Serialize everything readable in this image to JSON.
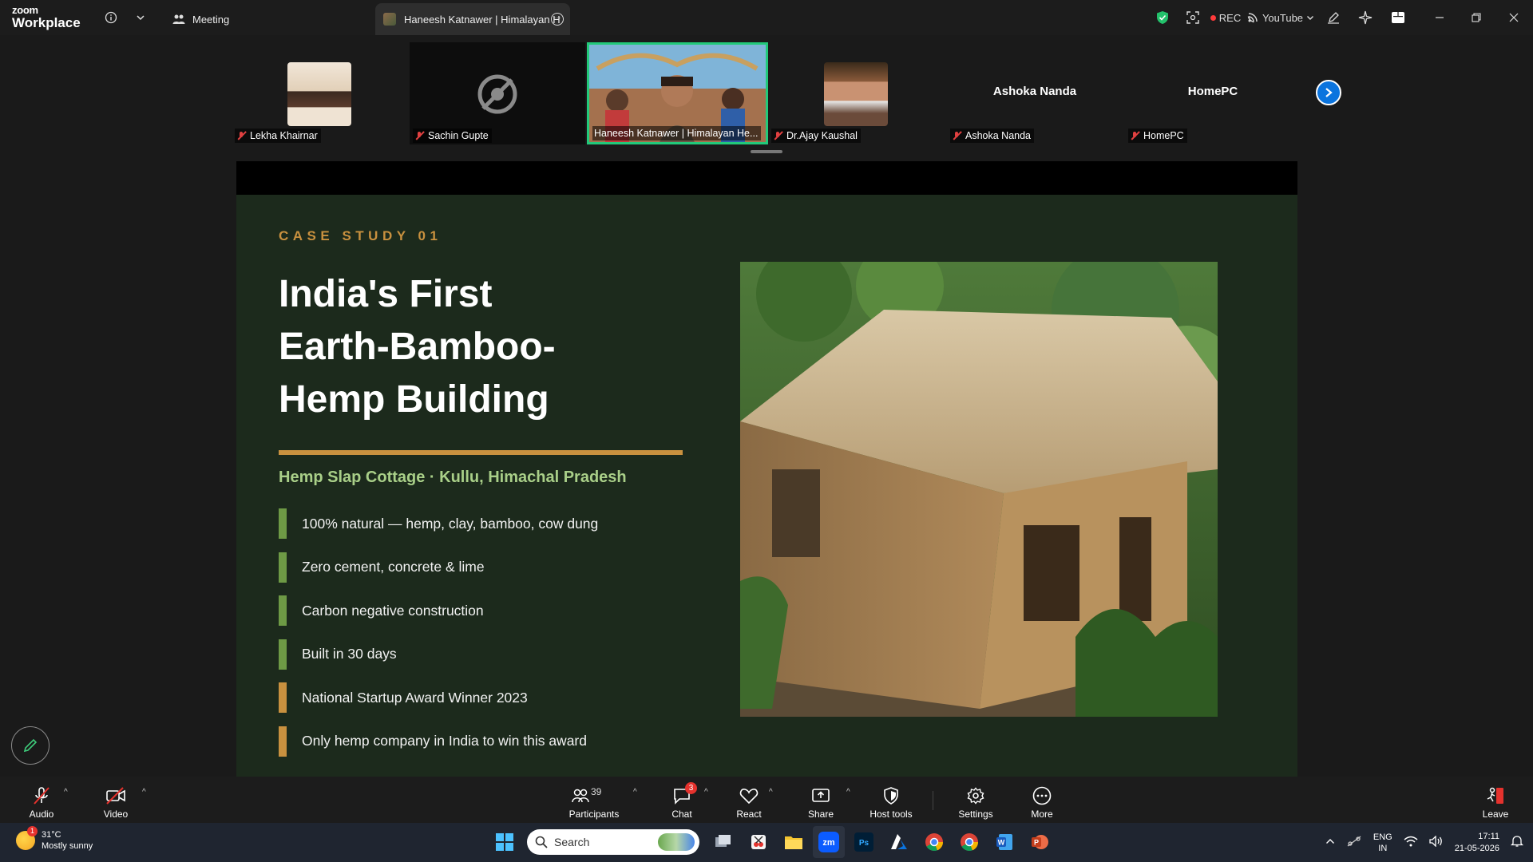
{
  "app": {
    "brand_top": "zoom",
    "brand_bottom": "Workplace",
    "tab_meeting": "Meeting",
    "tab_active": "Haneesh Katnawer | Himalayan H",
    "rec_label": "REC",
    "youtube_label": "YouTube"
  },
  "gallery": {
    "participants": [
      {
        "name": "Lekha Khairnar"
      },
      {
        "name": "Sachin Gupte"
      },
      {
        "name": "Haneesh Katnawer | Himalayan He..."
      },
      {
        "name": "Dr.Ajay Kaushal"
      },
      {
        "name": "Ashoka Nanda",
        "display_name": "Ashoka Nanda"
      },
      {
        "name": "HomePC",
        "display_name": "HomePC"
      }
    ]
  },
  "slide": {
    "eyebrow": "CASE STUDY   01",
    "headline": "India's First\nEarth-Bamboo-\nHemp Building",
    "subtitle": "Hemp Slap Cottage  ·  Kullu, Himachal Pradesh",
    "bullets": [
      {
        "text": "100% natural — hemp, clay, bamboo, cow dung",
        "color": "#6e9a45"
      },
      {
        "text": "Zero cement, concrete & lime",
        "color": "#6e9a45"
      },
      {
        "text": "Carbon negative construction",
        "color": "#6e9a45"
      },
      {
        "text": "Built in 30 days",
        "color": "#6e9a45"
      },
      {
        "text": "National Startup Award Winner 2023",
        "color": "#c9913f"
      },
      {
        "text": "Only hemp company in India to win this award",
        "color": "#c9913f"
      }
    ],
    "accent": "#c9913f",
    "subtitle_color": "#a9cf88",
    "background": "#1c2a1c"
  },
  "controls": {
    "audio": "Audio",
    "video": "Video",
    "participants": "Participants",
    "participants_count": "39",
    "chat": "Chat",
    "chat_badge": "3",
    "react": "React",
    "share": "Share",
    "host_tools": "Host tools",
    "settings": "Settings",
    "more": "More",
    "leave": "Leave"
  },
  "taskbar": {
    "temp": "31°C",
    "weather": "Mostly sunny",
    "weather_badge": "1",
    "search_placeholder": "Search",
    "lang_top": "ENG",
    "lang_bottom": "IN",
    "time": "17:11",
    "date": "21-05-2026"
  }
}
